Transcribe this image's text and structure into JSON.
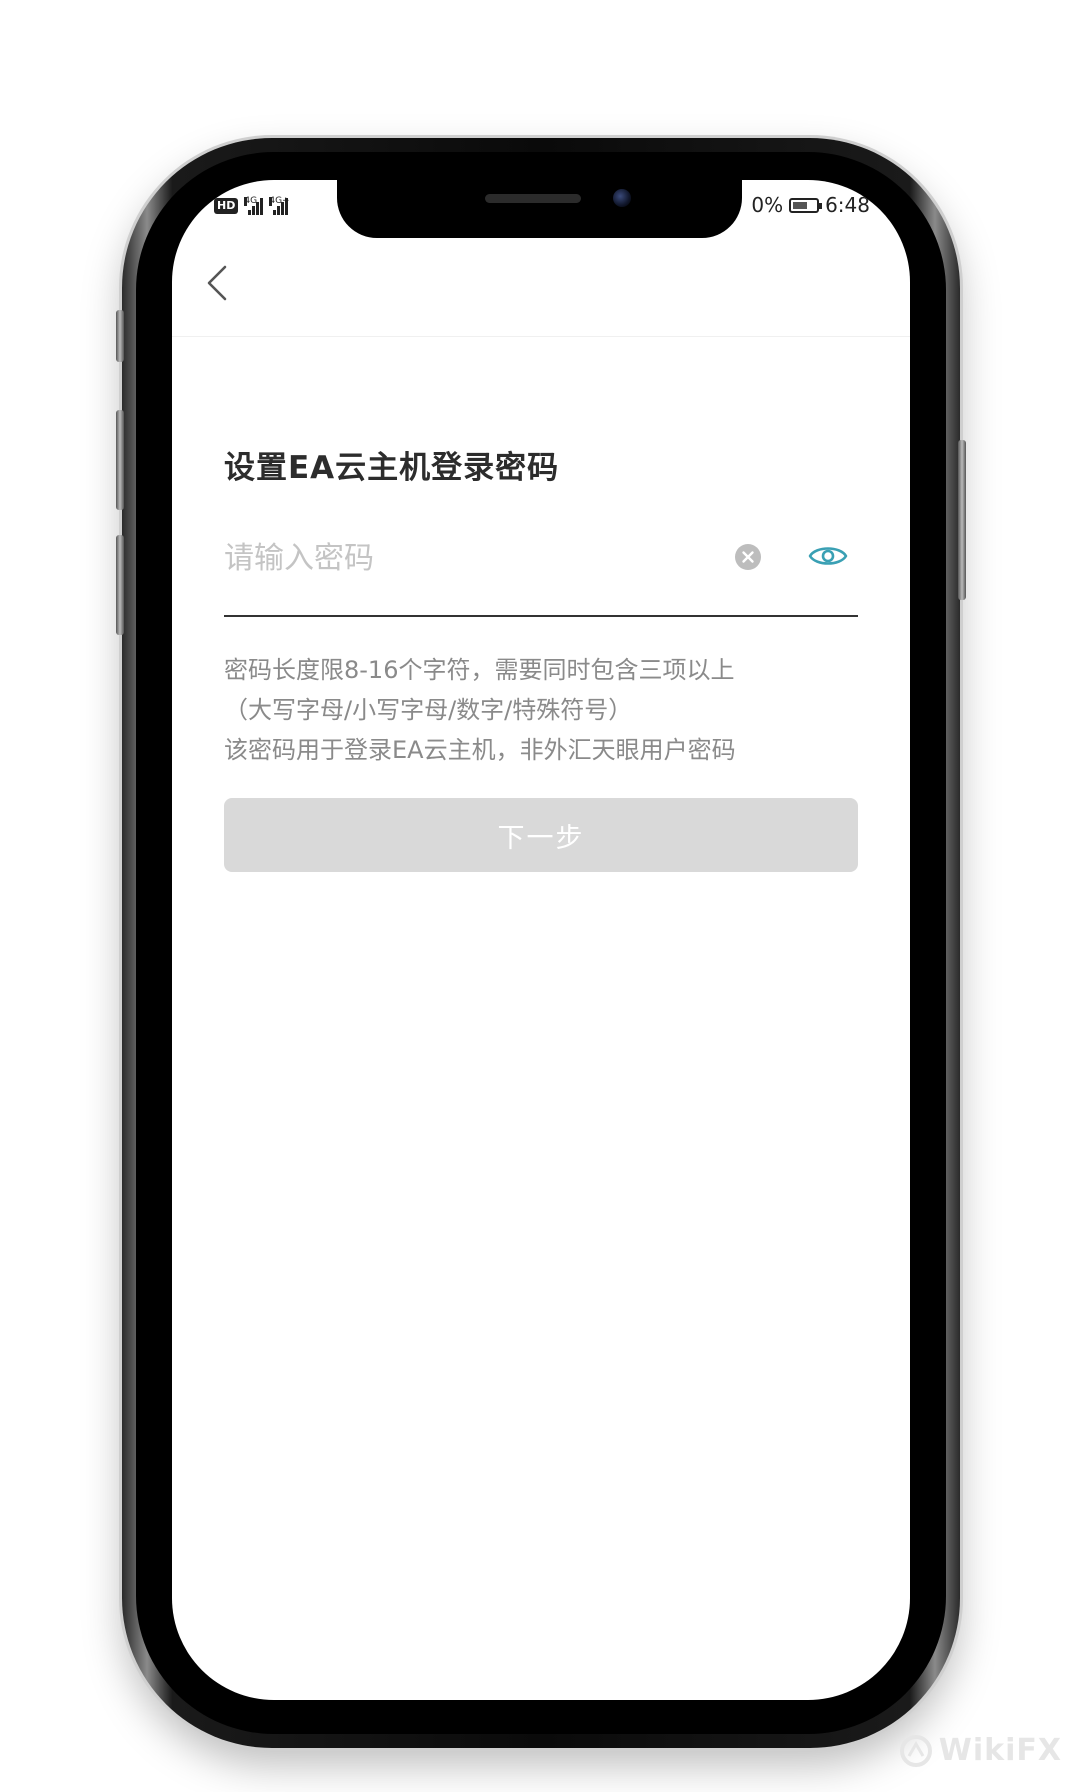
{
  "status_bar": {
    "hd_label": "HD",
    "sim1_label": "4G",
    "sim2_label": "4G+",
    "battery_percent": "0%",
    "time": "6:48"
  },
  "header": {
    "back_icon": "chevron-left-icon"
  },
  "main": {
    "title": "设置EA云主机登录密码",
    "password_placeholder": "请输入密码",
    "password_value": "",
    "clear_icon": "clear-circle-icon",
    "visibility_icon": "eye-icon",
    "rules": [
      "密码长度限8-16个字符，需要同时包含三项以上",
      "（大写字母/小写字母/数字/特殊符号）",
      "该密码用于登录EA云主机，非外汇天眼用户密码"
    ],
    "next_label": "下一步"
  },
  "watermark": {
    "text": "WikiFX"
  },
  "colors": {
    "accent_eye": "#3aa0b4",
    "title_text": "#2c2c2c",
    "hint_text": "#8a8a8a",
    "disabled_button": "#d9d9d9",
    "underline": "#333333"
  }
}
